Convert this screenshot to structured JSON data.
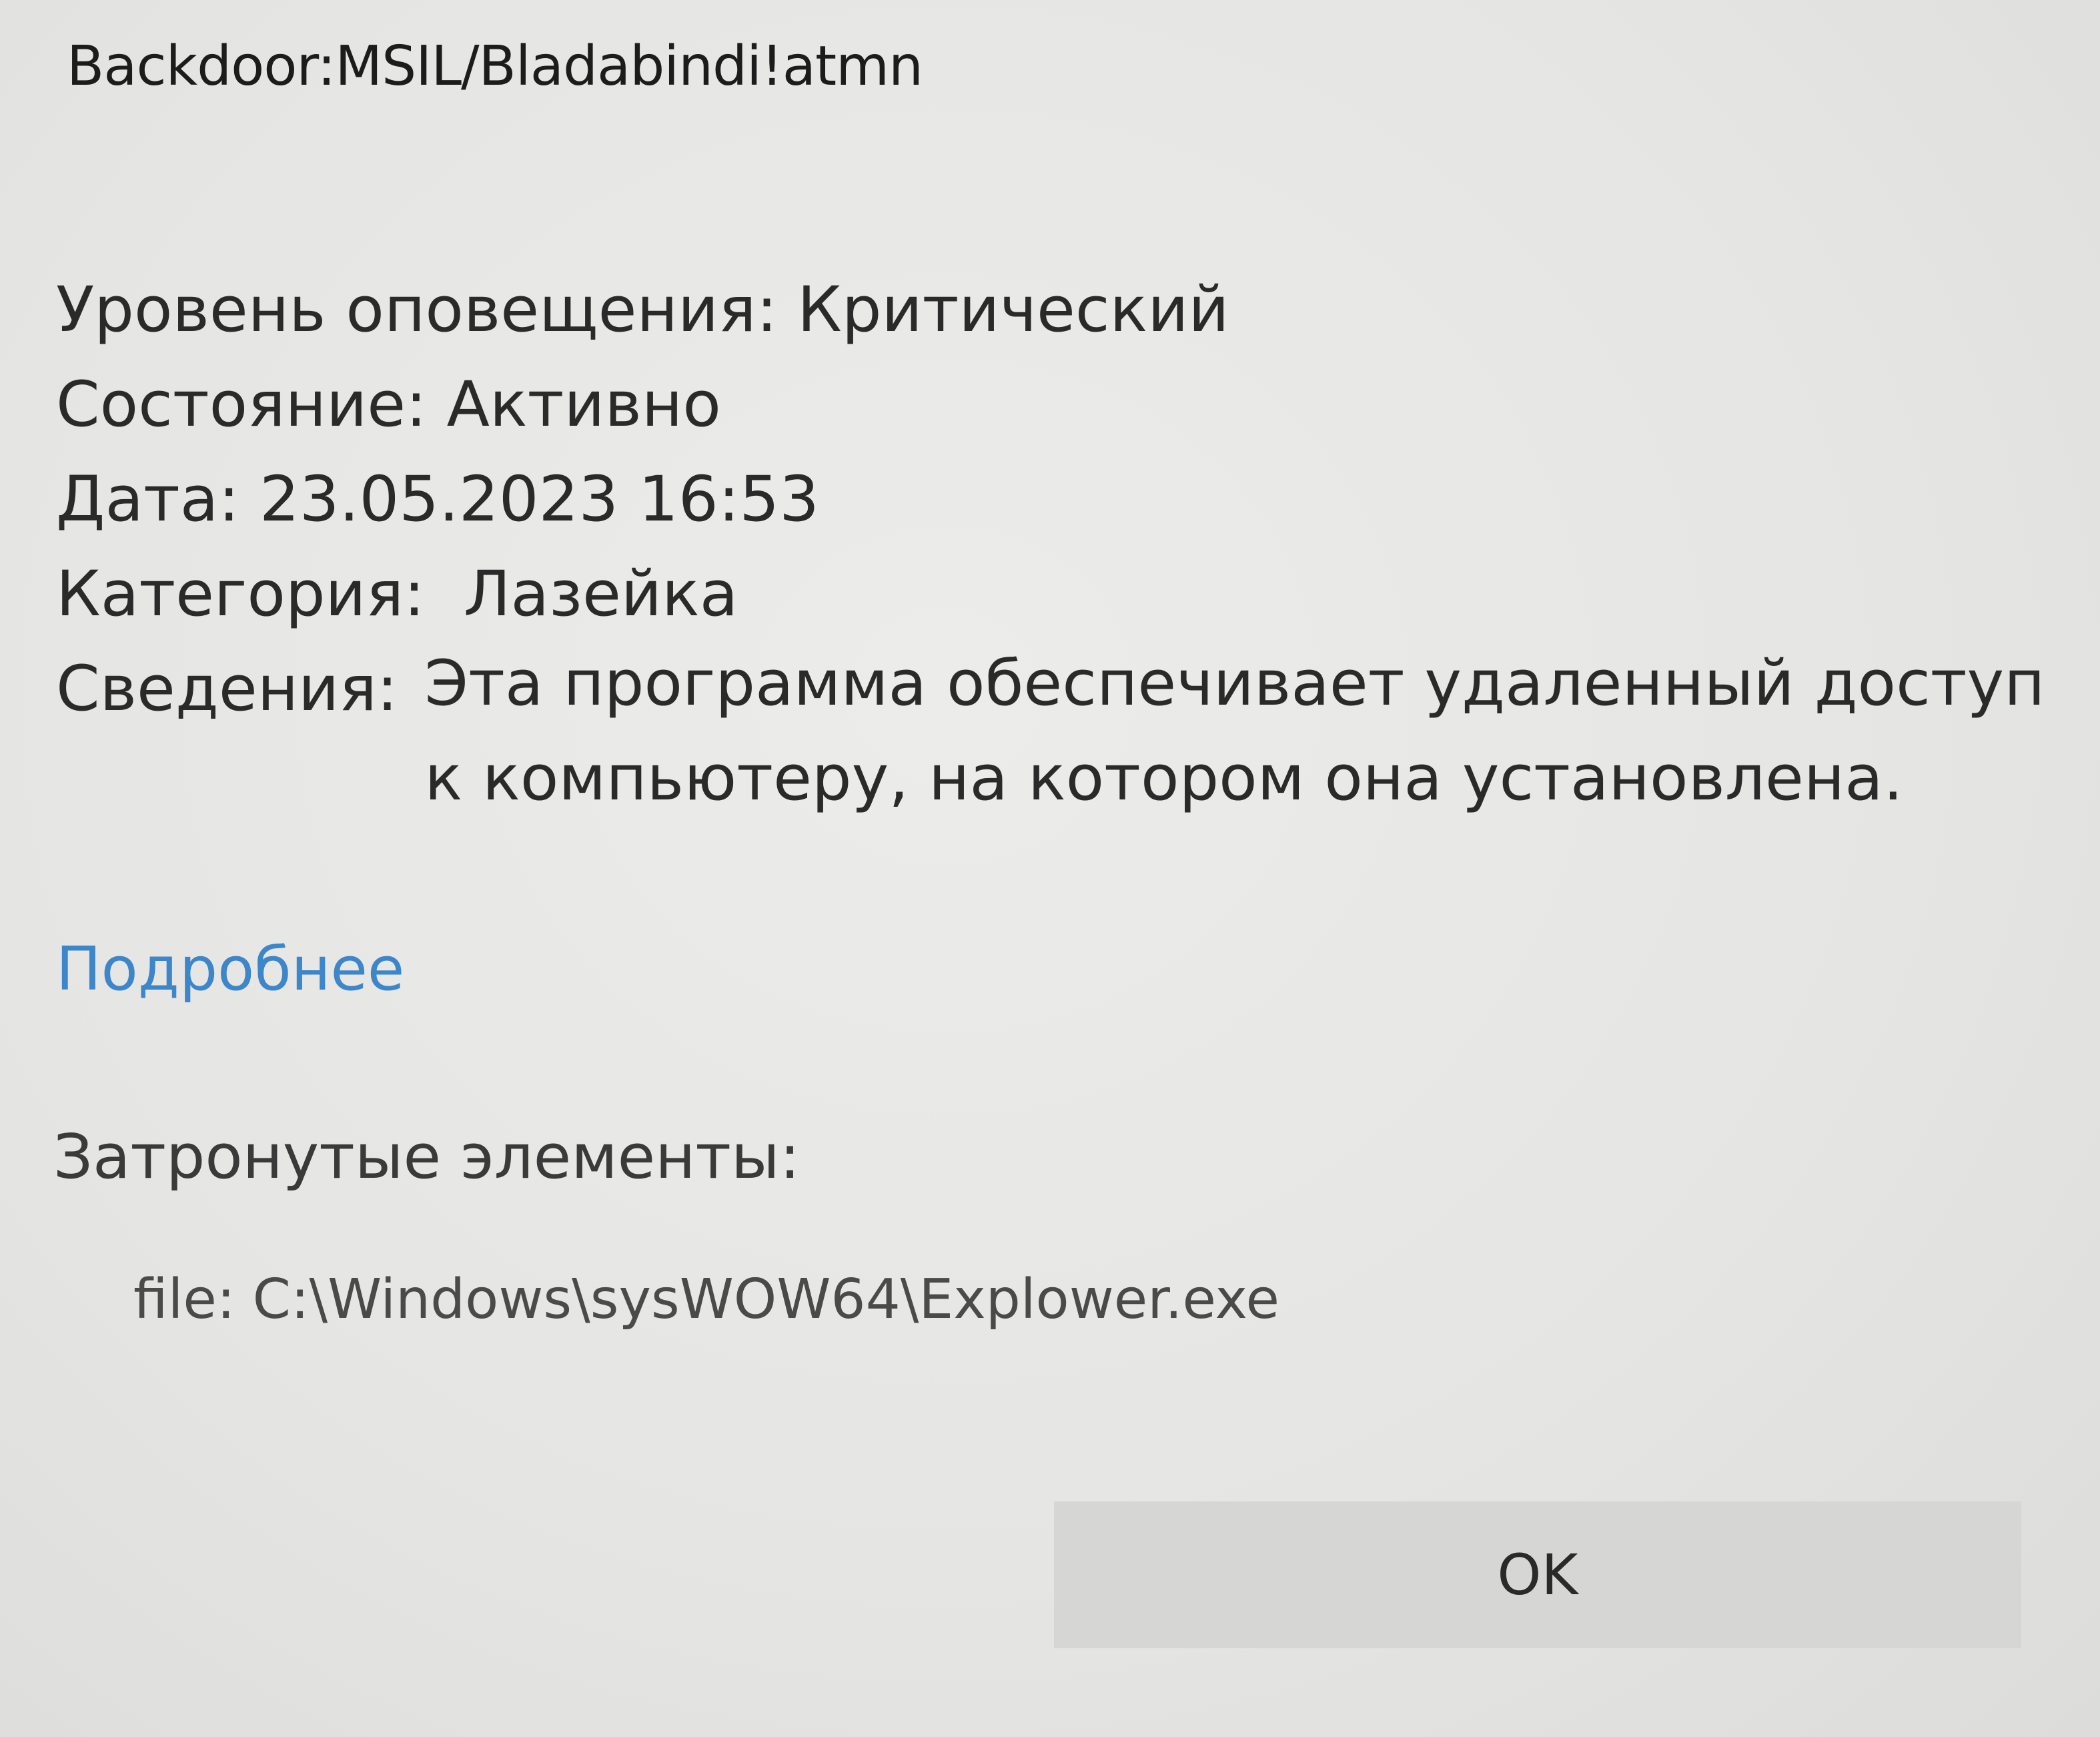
{
  "header": {
    "threat_name": "Backdoor:MSIL/Bladabindi!atmn"
  },
  "details": {
    "alert_level": "Уровень оповещения: Критический",
    "status": "Состояние: Активно",
    "date": "Дата: 23.05.2023 16:53",
    "category_label": "Категория:",
    "category_value": "Лазейка",
    "info_label": "Сведения:",
    "info_value": "Эта программа обеспечивает удаленный доступ к компьютеру, на котором она установлена."
  },
  "links": {
    "more": "Подробнее"
  },
  "affected": {
    "title": "Затронутые элементы:",
    "items": [
      "file: C:\\Windows\\sysWOW64\\Explower.exe"
    ]
  },
  "buttons": {
    "ok": "OK"
  }
}
